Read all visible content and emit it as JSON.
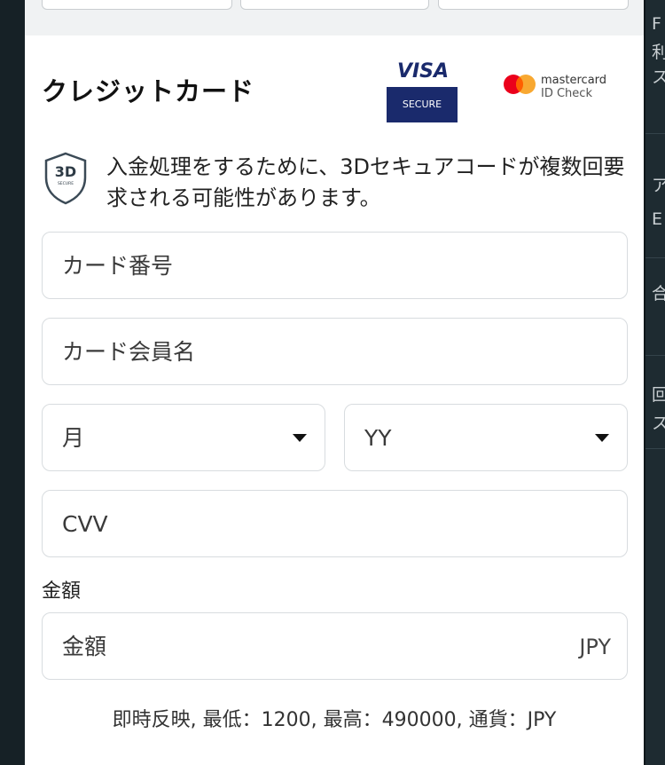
{
  "header": {
    "title": "クレジットカード",
    "visa_logo": {
      "brand": "VISA",
      "secure_label": "SECURE"
    },
    "mastercard_logo": {
      "line1": "mastercard",
      "line2": "ID Check"
    }
  },
  "notice": {
    "icon_label": "3D",
    "icon_sub": "SECURE",
    "text": "入金処理をするために、3Dセキュアコードが複数回要求される可能性があります。"
  },
  "form": {
    "card_number": {
      "placeholder": "カード番号"
    },
    "card_holder": {
      "placeholder": "カード会員名"
    },
    "month_select": {
      "value": "月"
    },
    "year_select": {
      "value": "YY"
    },
    "cvv": {
      "placeholder": "CVV"
    },
    "amount": {
      "label": "金額",
      "placeholder": "金額",
      "currency": "JPY"
    }
  },
  "footnote": "即時反映, 最低：1200, 最高：490000, 通貨：JPY",
  "background_fragments": [
    "F",
    "利",
    "ス",
    "ア",
    "E",
    "合",
    "回",
    "ス"
  ],
  "colors": {
    "visa_blue": "#1a2a6c",
    "mc_red": "#eb001b",
    "mc_orange": "#f79e1b",
    "backdrop": "#162126"
  }
}
